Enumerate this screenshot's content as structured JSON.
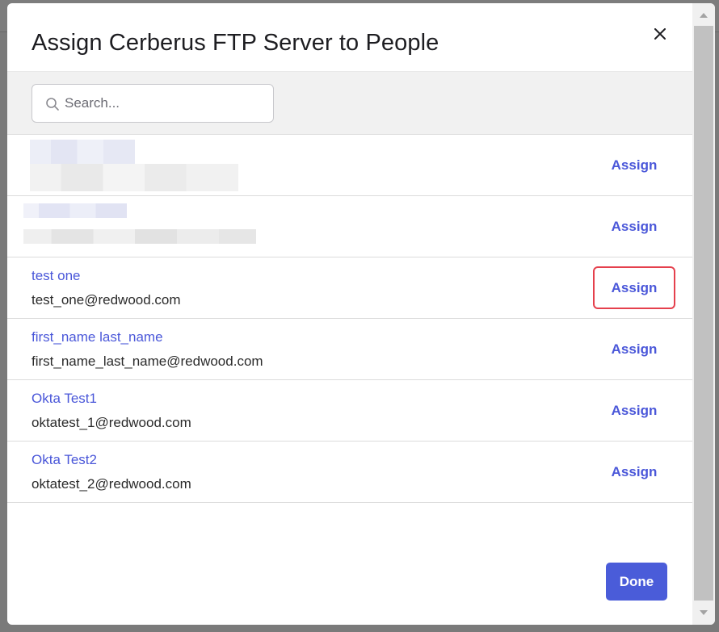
{
  "modal": {
    "title": "Assign Cerberus FTP Server to People",
    "close_icon": "close-icon"
  },
  "search": {
    "placeholder": "Search...",
    "value": ""
  },
  "people": [
    {
      "name": "",
      "email": "",
      "assign_label": "Assign",
      "redacted": true
    },
    {
      "name": "",
      "email": "",
      "assign_label": "Assign",
      "redacted": true
    },
    {
      "name": "test one",
      "email": "test_one@redwood.com",
      "assign_label": "Assign",
      "redacted": false,
      "highlighted": true
    },
    {
      "name": "first_name last_name",
      "email": "first_name_last_name@redwood.com",
      "assign_label": "Assign",
      "redacted": false
    },
    {
      "name": "Okta Test1",
      "email": "oktatest_1@redwood.com",
      "assign_label": "Assign",
      "redacted": false
    },
    {
      "name": "Okta Test2",
      "email": "oktatest_2@redwood.com",
      "assign_label": "Assign",
      "redacted": false
    }
  ],
  "footer": {
    "done_label": "Done"
  },
  "colors": {
    "accent": "#4a57d9",
    "done_button": "#4a5cd9",
    "highlight_border": "#e5404d"
  }
}
